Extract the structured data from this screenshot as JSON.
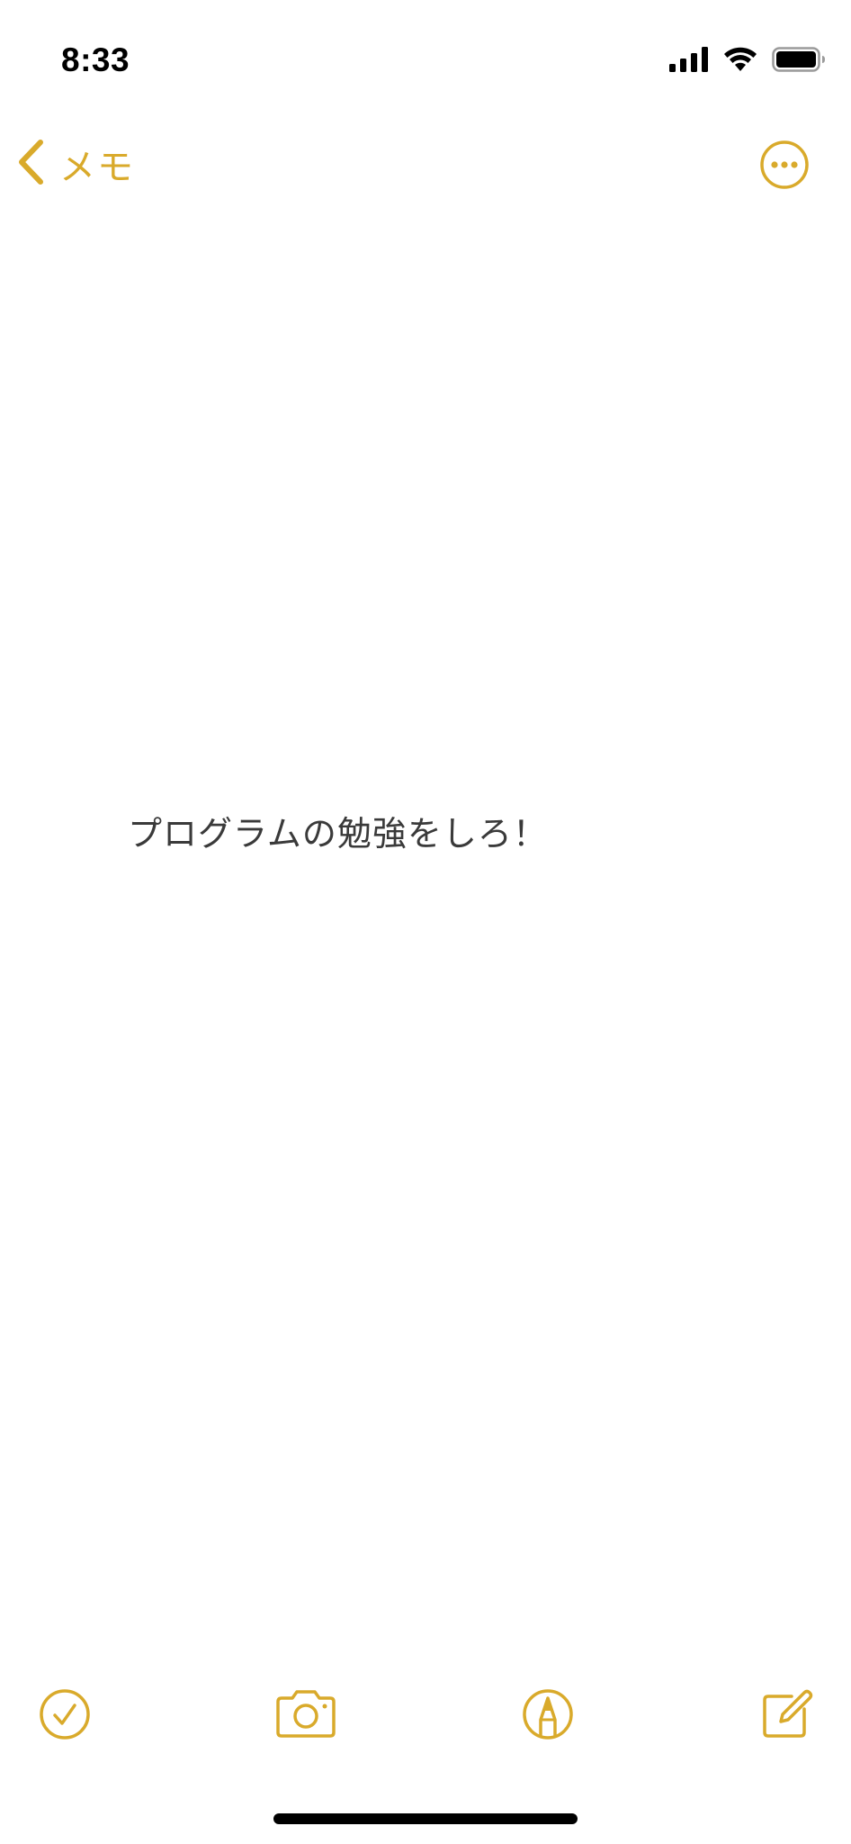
{
  "status_bar": {
    "time": "8:33",
    "icons": [
      "cellular-signal-icon",
      "wifi-icon",
      "battery-icon"
    ]
  },
  "nav": {
    "back_label": "メモ",
    "back_icon": "chevron-left-icon",
    "more_icon": "ellipsis-circle-icon"
  },
  "note": {
    "text": "プログラムの勉強をしろ！"
  },
  "toolbar": {
    "items": [
      {
        "icon": "checklist-icon"
      },
      {
        "icon": "camera-icon"
      },
      {
        "icon": "markup-pen-icon"
      },
      {
        "icon": "compose-icon"
      }
    ]
  },
  "colors": {
    "accent": "#d9aa2b",
    "text": "#3a3a3a",
    "background": "#ffffff"
  }
}
